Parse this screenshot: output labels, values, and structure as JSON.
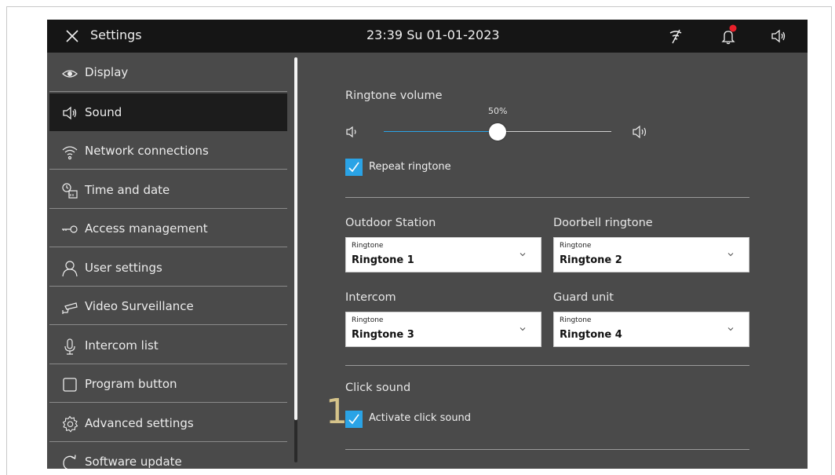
{
  "header": {
    "title": "Settings",
    "clock": "23:39  Su 01-01-2023"
  },
  "sidebar": {
    "items": [
      {
        "label": "Display",
        "icon": "eye-icon"
      },
      {
        "label": "Sound",
        "icon": "speaker-icon",
        "active": true
      },
      {
        "label": "Network connections",
        "icon": "wifi-icon"
      },
      {
        "label": "Time and date",
        "icon": "clock-calendar-icon"
      },
      {
        "label": "Access  management",
        "icon": "key-icon"
      },
      {
        "label": "User settings",
        "icon": "user-icon"
      },
      {
        "label": "Video Surveillance",
        "icon": "camera-icon"
      },
      {
        "label": "Intercom list",
        "icon": "microphone-icon"
      },
      {
        "label": "Program button",
        "icon": "square-icon"
      },
      {
        "label": "Advanced settings",
        "icon": "gear-icon"
      },
      {
        "label": "Software update",
        "icon": "refresh-icon"
      }
    ]
  },
  "sound": {
    "ringtone_volume_label": "Ringtone volume",
    "volume_percent_text": "50%",
    "volume_value": 50,
    "repeat_ringtone_label": "Repeat ringtone",
    "repeat_ringtone_checked": true,
    "outdoor_station_label": "Outdoor Station",
    "doorbell_ringtone_label": "Doorbell ringtone",
    "intercom_label": "Intercom",
    "guard_unit_label": "Guard unit",
    "dropdown_caption": "Ringtone",
    "outdoor_station_value": "Ringtone 1",
    "doorbell_ringtone_value": "Ringtone 2",
    "intercom_value": "Ringtone 3",
    "guard_unit_value": "Ringtone 4",
    "click_sound_label": "Click sound",
    "activate_click_sound_label": "Activate click sound",
    "activate_click_sound_checked": true
  },
  "annotation": {
    "marker": "1"
  },
  "colors": {
    "accent": "#2aa3e6",
    "topbar": "#151515",
    "background": "#4a4a4a",
    "notification": "#e8202a",
    "annotation": "#d5c38a"
  }
}
